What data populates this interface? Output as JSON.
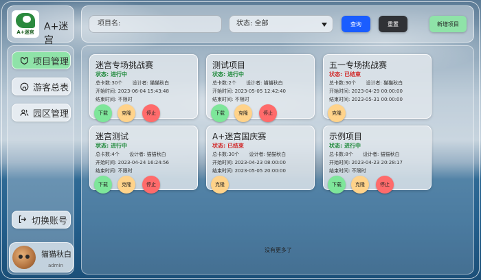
{
  "app": {
    "title": "A+迷宫",
    "logo_text": "A+迷宫"
  },
  "sidebar": {
    "items": [
      {
        "label": "项目管理",
        "icon": "heart-shield-icon",
        "active": true
      },
      {
        "label": "游客总表",
        "icon": "github-icon",
        "active": false
      },
      {
        "label": "园区管理",
        "icon": "users-icon",
        "active": false
      }
    ],
    "switch_account": "切换账号",
    "user": {
      "name": "猫猫秋白",
      "role": "admin"
    }
  },
  "toolbar": {
    "search_placeholder": "项目名:",
    "status_label": "状态: 全部",
    "query_label": "查询",
    "reset_label": "重置",
    "new_label": "新增项目"
  },
  "colors": {
    "active_green": "#8fe3a8",
    "query_blue": "#1a5dff",
    "reset_dark": "#303236",
    "running": "#1f8a3b",
    "ended": "#d12a2a",
    "download": "#7ee69a",
    "clone": "#ffd38a",
    "stop": "#ff6b6b"
  },
  "labels": {
    "total_prefix": "总卡数:",
    "designer_prefix": "设计者:",
    "start_prefix": "开始时间:",
    "end_prefix": "结束时间:",
    "download": "下载",
    "clone": "克隆",
    "stop": "停止"
  },
  "projects": [
    {
      "title": "迷宫专场挑战赛",
      "status": "状态: 进行中",
      "count": "30个",
      "designer": "猫猫秋白",
      "start": "2023-06-04 15:43:48",
      "end": "不限时"
    },
    {
      "title": "测试项目",
      "status": "状态: 进行中",
      "count": "2个",
      "designer": "猫猫秋白",
      "start": "2023-05-05 12:42:40",
      "end": "不限时"
    },
    {
      "title": "五一专场挑战赛",
      "status": "状态: 已结束",
      "count": "30个",
      "designer": "猫猫秋白",
      "start": "2023-04-29 00:00:00",
      "end": "2023-05-31 00:00:00"
    },
    {
      "title": "迷宫测试",
      "status": "状态: 进行中",
      "count": "4个",
      "designer": "猫猫秋白",
      "start": "2023-04-24 16:24:56",
      "end": "不限时"
    },
    {
      "title": "A+迷宫国庆赛",
      "status": "状态: 已结束",
      "count": "30个",
      "designer": "猫猫秋白",
      "start": "2023-04-23 08:00:00",
      "end": "2023-05-05 20:00:00"
    },
    {
      "title": "示例项目",
      "status": "状态: 进行中",
      "count": "8个",
      "designer": "猫猫秋白",
      "start": "2023-04-23 20:28:17",
      "end": "不限时"
    }
  ],
  "footer": {
    "no_more": "没有更多了"
  }
}
